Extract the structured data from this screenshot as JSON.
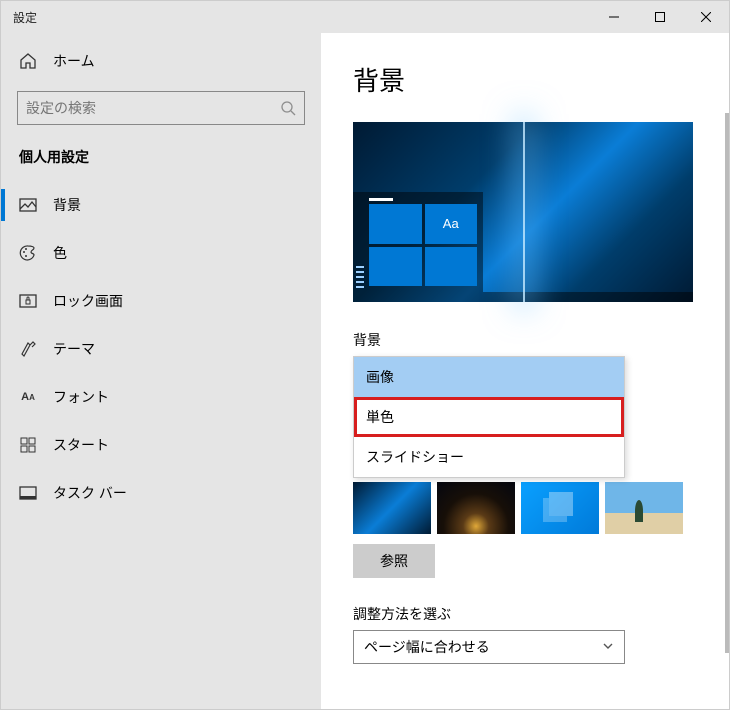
{
  "window": {
    "title": "設定"
  },
  "sidebar": {
    "home_label": "ホーム",
    "search_placeholder": "設定の検索",
    "category": "個人用設定",
    "items": [
      {
        "label": "背景",
        "icon": "picture-icon",
        "active": true
      },
      {
        "label": "色",
        "icon": "palette-icon"
      },
      {
        "label": "ロック画面",
        "icon": "lockscreen-icon"
      },
      {
        "label": "テーマ",
        "icon": "theme-icon"
      },
      {
        "label": "フォント",
        "icon": "font-icon"
      },
      {
        "label": "スタート",
        "icon": "start-icon"
      },
      {
        "label": "タスク バー",
        "icon": "taskbar-icon"
      }
    ]
  },
  "content": {
    "title": "背景",
    "preview_tile_text": "Aa",
    "background_label": "背景",
    "dropdown_options": [
      {
        "label": "画像",
        "selected": true
      },
      {
        "label": "単色",
        "highlighted": true
      },
      {
        "label": "スライドショー"
      }
    ],
    "browse_label": "参照",
    "fit_label": "調整方法を選ぶ",
    "fit_value": "ページ幅に合わせる"
  }
}
